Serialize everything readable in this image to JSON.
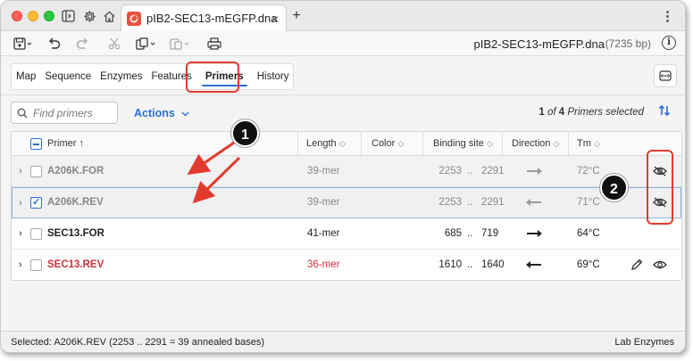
{
  "tab": {
    "title": "pIB2-SEC13-mEGFP.dna",
    "close": "×",
    "new_tab": "+"
  },
  "toolbar": {
    "file_name": "pIB2-SEC13-mEGFP.dna",
    "file_size": "(7235 bp)"
  },
  "nav": {
    "tabs": [
      {
        "label": "Map",
        "active": false
      },
      {
        "label": "Sequence",
        "active": false
      },
      {
        "label": "Enzymes",
        "active": false
      },
      {
        "label": "Features",
        "active": false
      },
      {
        "label": "Primers",
        "active": true
      },
      {
        "label": "History",
        "active": false
      }
    ]
  },
  "search": {
    "placeholder": "Find primers"
  },
  "actions_label": "Actions",
  "selection": {
    "current": "1",
    "of": "of",
    "total": "4",
    "suffix": "Primers selected"
  },
  "table": {
    "columns": {
      "primer": "Primer ↑",
      "length": "Length",
      "color": "Color",
      "binding": "Binding site",
      "direction": "Direction",
      "tm": "Tm"
    },
    "rows": [
      {
        "name": "A206K.FOR",
        "length": "39-mer",
        "site_start": "2253",
        "site_sep": "..",
        "site_end": "2291",
        "direction": "forward",
        "tm": "72°C",
        "checked": false,
        "style": "dim"
      },
      {
        "name": "A206K.REV",
        "length": "39-mer",
        "site_start": "2253",
        "site_sep": "..",
        "site_end": "2291",
        "direction": "reverse",
        "tm": "71°C",
        "checked": true,
        "style": "selected"
      },
      {
        "name": "SEC13.FOR",
        "length": "41-mer",
        "site_start": "685",
        "site_sep": "..",
        "site_end": "719",
        "direction": "forward",
        "tm": "64°C",
        "checked": false,
        "style": "normal"
      },
      {
        "name": "SEC13.REV",
        "length": "36-mer",
        "site_start": "1610",
        "site_sep": "..",
        "site_end": "1640",
        "direction": "reverse",
        "tm": "69°C",
        "checked": false,
        "style": "red"
      }
    ]
  },
  "callouts": {
    "one": "1",
    "two": "2"
  },
  "status": {
    "left": "Selected:  A206K.REV   (2253 .. 2291  =  39 annealed bases)",
    "right": "Lab Enzymes"
  },
  "colors": {
    "accent": "#2a6fd6",
    "highlight": "#e23b2e",
    "red_text": "#cf2f3a",
    "app_badge": "#e8533f"
  }
}
